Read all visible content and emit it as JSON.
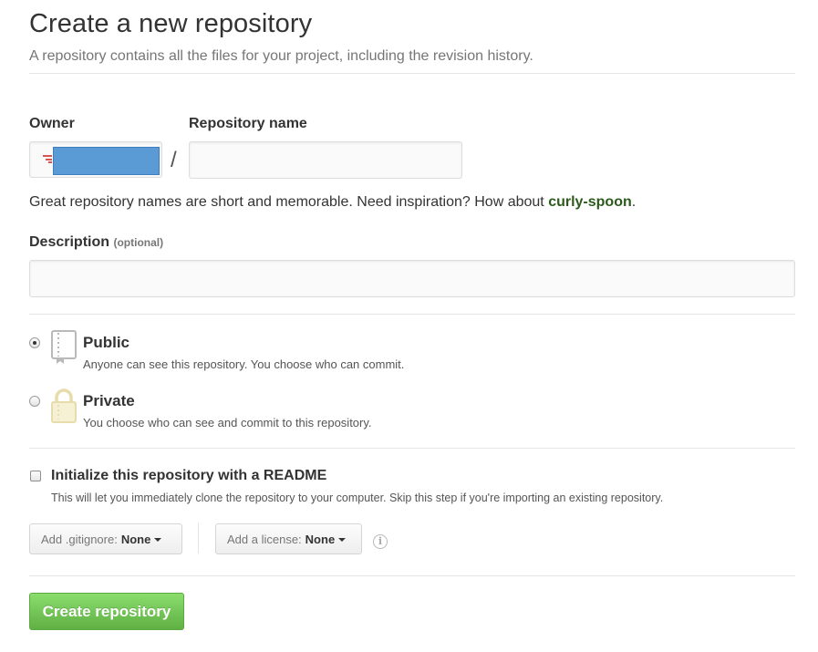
{
  "header": {
    "title": "Create a new repository",
    "subtitle": "A repository contains all the files for your project, including the revision history."
  },
  "form": {
    "owner_label": "Owner",
    "repo_label": "Repository name",
    "slash": "/",
    "repo_value": "",
    "hint_text": "Great repository names are short and memorable. Need inspiration? How about ",
    "suggestion": "curly-spoon",
    "hint_end": ".",
    "description_label": "Description",
    "description_optional": "(optional)",
    "description_value": ""
  },
  "visibility": {
    "selected": "public",
    "public_title": "Public",
    "public_note": "Anyone can see this repository. You choose who can commit.",
    "private_title": "Private",
    "private_note": "You choose who can see and commit to this repository."
  },
  "init": {
    "readme_label": "Initialize this repository with a README",
    "readme_note": "This will let you immediately clone the repository to your computer. Skip this step if you're importing an existing repository.",
    "readme_checked": false,
    "gitignore_label": "Add .gitignore:",
    "gitignore_value": "None",
    "license_label": "Add a license:",
    "license_value": "None",
    "info_glyph": "i"
  },
  "actions": {
    "create_label": "Create repository"
  },
  "colors": {
    "accent_green": "#60b044",
    "suggestion_green": "#2c5a1c",
    "redaction_blue": "#5b9bd5"
  },
  "icons": {
    "public": "repo-book-icon",
    "private": "lock-icon",
    "info": "info-icon"
  }
}
